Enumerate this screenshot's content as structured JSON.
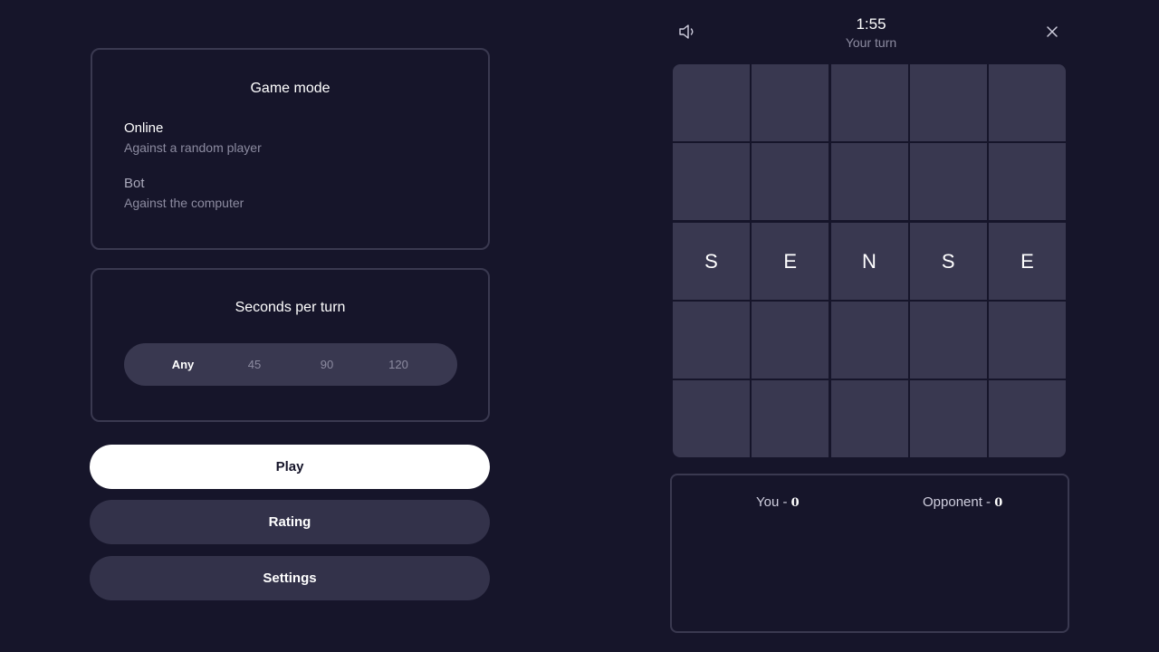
{
  "game_mode": {
    "title": "Game mode",
    "options": [
      {
        "name": "Online",
        "description": "Against a random player"
      },
      {
        "name": "Bot",
        "description": "Against the computer"
      }
    ],
    "selected": "Online"
  },
  "seconds_per_turn": {
    "title": "Seconds per turn",
    "options": [
      "Any",
      "45",
      "90",
      "120"
    ],
    "selected": "Any"
  },
  "buttons": {
    "play": "Play",
    "rating": "Rating",
    "settings": "Settings"
  },
  "header": {
    "timer": "1:55",
    "status": "Your turn"
  },
  "board": {
    "rows": [
      [
        "",
        "",
        "",
        "",
        ""
      ],
      [
        "",
        "",
        "",
        "",
        ""
      ],
      [
        "S",
        "E",
        "N",
        "S",
        "E"
      ],
      [
        "",
        "",
        "",
        "",
        ""
      ],
      [
        "",
        "",
        "",
        "",
        ""
      ]
    ]
  },
  "scores": {
    "you_label": "You - ",
    "you_value": "0",
    "opponent_label": "Opponent - ",
    "opponent_value": "0"
  },
  "icons": {
    "sound": "speaker-icon",
    "close": "close-icon"
  },
  "colors": {
    "background": "#16152a",
    "cell": "#393850",
    "accent_button": "#ffffff"
  }
}
